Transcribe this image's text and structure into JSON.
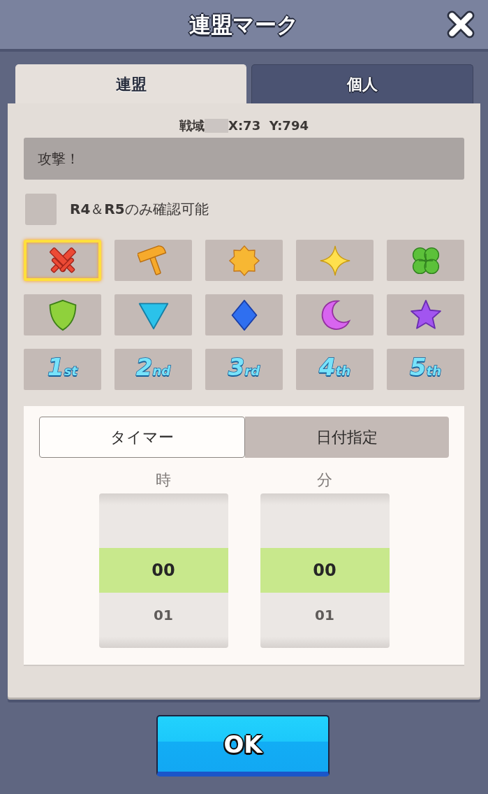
{
  "window": {
    "title": "連盟マーク"
  },
  "tabs": [
    {
      "label": "連盟",
      "selected": true
    },
    {
      "label": "個人",
      "selected": false
    }
  ],
  "location": {
    "area": "戦域",
    "redacted": true,
    "coords": "X:73  Y:794"
  },
  "message": {
    "value": "攻撃！"
  },
  "visibility_option": {
    "label": "**R4**＆**R5**のみ確認可能",
    "checked": false
  },
  "marks": [
    {
      "kind": "icon",
      "selected": true
    },
    {
      "kind": "icon",
      "selected": false
    },
    {
      "kind": "icon",
      "selected": false
    },
    {
      "kind": "icon",
      "selected": false
    },
    {
      "kind": "icon",
      "selected": false
    },
    {
      "kind": "icon",
      "selected": false
    },
    {
      "kind": "icon",
      "selected": false
    },
    {
      "kind": "icon",
      "selected": false
    },
    {
      "kind": "icon",
      "selected": false
    },
    {
      "kind": "icon",
      "selected": false
    },
    {
      "kind": "rank",
      "number": "1",
      "suffix": "st",
      "selected": false
    },
    {
      "kind": "rank",
      "number": "2",
      "suffix": "nd",
      "selected": false
    },
    {
      "kind": "rank",
      "number": "3",
      "suffix": "rd",
      "selected": false
    },
    {
      "kind": "rank",
      "number": "4",
      "suffix": "th",
      "selected": false
    },
    {
      "kind": "rank",
      "number": "5",
      "suffix": "th",
      "selected": false
    }
  ],
  "timer_modes": [
    {
      "label": "タイマー",
      "selected": true
    },
    {
      "label": "日付指定",
      "selected": false
    }
  ],
  "pickers": [
    {
      "label": "時",
      "rows": [
        {
          "value": "00",
          "selected": true
        },
        {
          "value": "01",
          "selected": false
        }
      ]
    },
    {
      "label": "分",
      "rows": [
        {
          "value": "00",
          "selected": true
        },
        {
          "value": "01",
          "selected": false
        }
      ]
    }
  ],
  "ok_button": {
    "label": "OK"
  }
}
